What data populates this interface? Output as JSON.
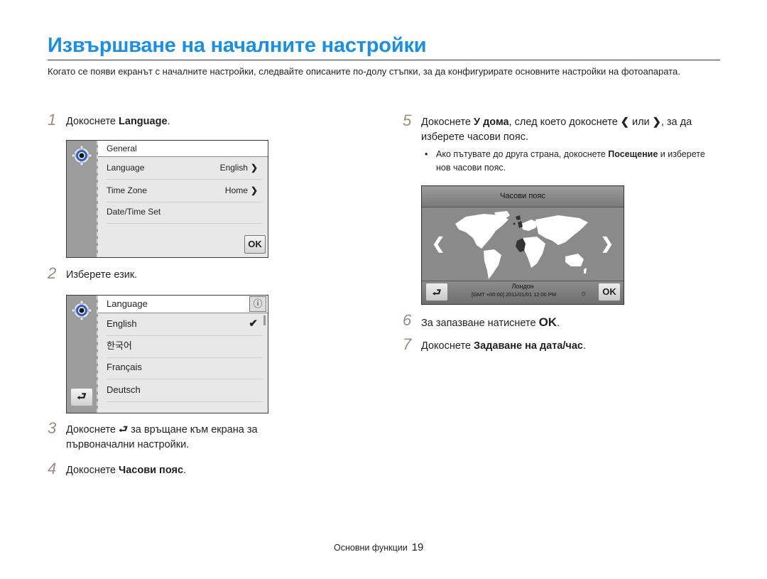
{
  "page": {
    "title": "Извършване на началните настройки",
    "intro": "Когато се появи екранът с началните настройки, следвайте описаните по-долу стъпки, за да конфигурирате основните настройки на фотоапарата.",
    "accent_color": "#1a8fe3"
  },
  "steps": [
    {
      "num": "1",
      "pre": "Докоснете ",
      "bold": "Language",
      "post": "."
    },
    {
      "num": "2",
      "text": "Изберете език."
    },
    {
      "num": "3",
      "pre": "Докоснете ",
      "icon": "back-icon",
      "post": " за връщане към екрана за първоначални настройки."
    },
    {
      "num": "4",
      "pre": "Докоснете ",
      "bold": "Часови пояс",
      "post": "."
    },
    {
      "num": "5",
      "pre": "Докоснете ",
      "bold": "У дома",
      "mid": ", след което докоснете ",
      "or": " или ",
      "post": ", за да изберете часови пояс."
    },
    {
      "num": "6",
      "pre": "За запазване натиснете ",
      "ok": "OK",
      "post": "."
    },
    {
      "num": "7",
      "pre": "Докоснете ",
      "bold": "Задаване на дата/час",
      "post": "."
    }
  ],
  "step5_note": {
    "pre": "Ако пътувате до друга страна, докоснете ",
    "bold": "Посещение",
    "post": " и изберете нов часови пояс."
  },
  "screen1": {
    "header": "General",
    "rows": [
      {
        "label": "Language",
        "value": "English"
      },
      {
        "label": "Time Zone",
        "value": "Home"
      },
      {
        "label": "Date/Time Set",
        "value": ""
      }
    ],
    "ok_label": "OK"
  },
  "screen2": {
    "header": "Language",
    "info_icon": "ⓘ",
    "languages": [
      "English",
      "한국어",
      "Français",
      "Deutsch"
    ],
    "selected": "English"
  },
  "worldclock": {
    "title": "Часови пояс",
    "city": "Лондон",
    "info": "[GMT +00:00] 2011/01/01 12:00 PM",
    "ok_label": "OK"
  },
  "footer": {
    "section": "Основни функции",
    "page_number": "19"
  }
}
